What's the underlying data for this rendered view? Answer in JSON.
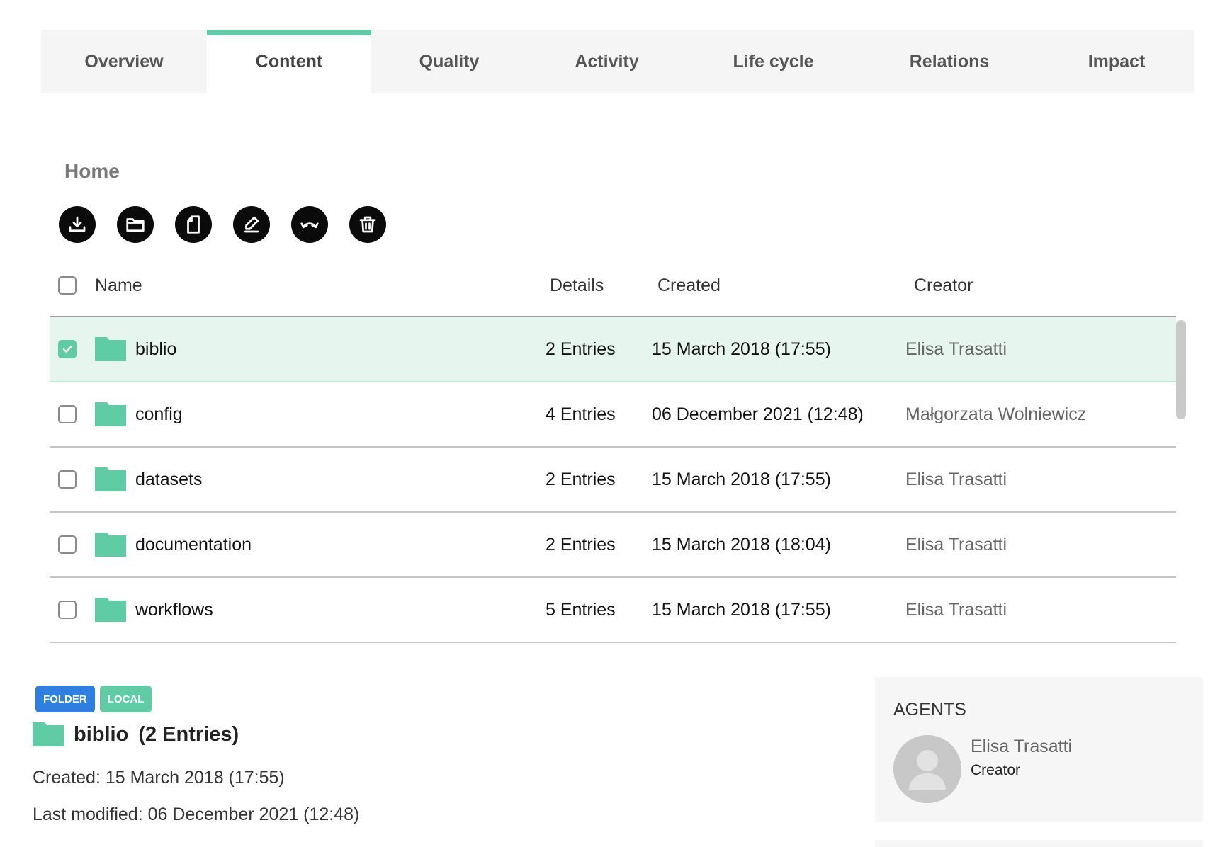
{
  "tabs": [
    {
      "label": "Overview"
    },
    {
      "label": "Content"
    },
    {
      "label": "Quality"
    },
    {
      "label": "Activity"
    },
    {
      "label": "Life cycle"
    },
    {
      "label": "Relations"
    },
    {
      "label": "Impact"
    }
  ],
  "active_tab": "Content",
  "breadcrumb": {
    "label": "Home"
  },
  "toolbar": {
    "icons": [
      "download-icon",
      "folder-icon",
      "file-icon",
      "edit-icon",
      "undo-icon",
      "trash-icon"
    ]
  },
  "table": {
    "headers": {
      "name": "Name",
      "details": "Details",
      "created": "Created",
      "creator": "Creator"
    },
    "rows": [
      {
        "name": "biblio",
        "details": "2 Entries",
        "created": "15 March 2018 (17:55)",
        "creator": "Elisa Trasatti",
        "selected": true
      },
      {
        "name": "config",
        "details": "4 Entries",
        "created": "06 December 2021 (12:48)",
        "creator": "Małgorzata Wolniewicz",
        "selected": false
      },
      {
        "name": "datasets",
        "details": "2 Entries",
        "created": "15 March 2018 (17:55)",
        "creator": "Elisa Trasatti",
        "selected": false
      },
      {
        "name": "documentation",
        "details": "2 Entries",
        "created": "15 March 2018 (18:04)",
        "creator": "Elisa Trasatti",
        "selected": false
      },
      {
        "name": "workflows",
        "details": "5 Entries",
        "created": "15 March 2018 (17:55)",
        "creator": "Elisa Trasatti",
        "selected": false
      }
    ]
  },
  "info": {
    "badges": {
      "type": "FOLDER",
      "scope": "LOCAL"
    },
    "name": "biblio",
    "entries": "(2 Entries)",
    "created": "Created: 15 March 2018 (17:55)",
    "modified": "Last modified: 06 December 2021 (12:48)"
  },
  "agents": {
    "title": "AGENTS",
    "name": "Elisa Trasatti",
    "role": "Creator"
  },
  "colors": {
    "accent": "#5fcca6",
    "badge_blue": "#2f7fe0",
    "selected_row": "#e6f6ef"
  }
}
